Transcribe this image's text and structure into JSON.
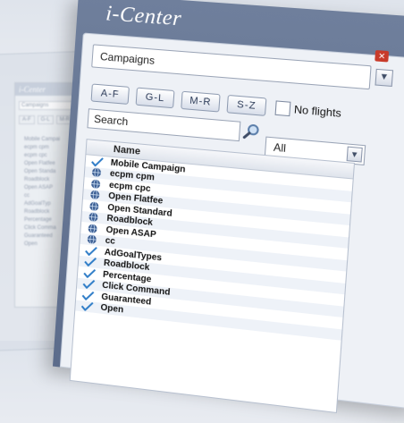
{
  "background": {
    "title": "i-Center",
    "field": "Campaigns",
    "buttons": [
      "A-F",
      "G-L",
      "M-R"
    ],
    "header": "Name",
    "items": [
      "Mobile Campai",
      "ecpm cpm",
      "ecpm cpc",
      "Open Flatfee",
      "Open Standa",
      "Roadblock",
      "Open ASAP",
      "cc",
      "AdGoalTyp",
      "Roadblock",
      "Percentage",
      "Click Comma",
      "Guaranteed",
      "Open"
    ]
  },
  "window": {
    "title": "i-Center",
    "campaign_select": "Campaigns",
    "filters": [
      "A-F",
      "G-L",
      "M-R",
      "S-Z"
    ],
    "no_flights_label": "No flights",
    "search_placeholder": "Search",
    "type_select": "All",
    "list_header": "Name"
  },
  "list_items": [
    {
      "label": "Mobile Campaign",
      "icon": "check"
    },
    {
      "label": "ecpm cpm",
      "icon": "globe"
    },
    {
      "label": "ecpm cpc",
      "icon": "globe"
    },
    {
      "label": "Open Flatfee",
      "icon": "globe"
    },
    {
      "label": "Open Standard",
      "icon": "globe"
    },
    {
      "label": "Roadblock",
      "icon": "globe"
    },
    {
      "label": "Open ASAP",
      "icon": "globe"
    },
    {
      "label": "cc",
      "icon": "globe"
    },
    {
      "label": "AdGoalTypes",
      "icon": "check"
    },
    {
      "label": "Roadblock",
      "icon": "check"
    },
    {
      "label": "Percentage",
      "icon": "check"
    },
    {
      "label": "Click Command",
      "icon": "check"
    },
    {
      "label": "Guaranteed",
      "icon": "check"
    },
    {
      "label": "Open",
      "icon": "check"
    }
  ],
  "colors": {
    "title_bar": "#6f7f9c",
    "check": "#2e7cc7",
    "globe": "#3c5f94",
    "close": "#c83a2a"
  }
}
